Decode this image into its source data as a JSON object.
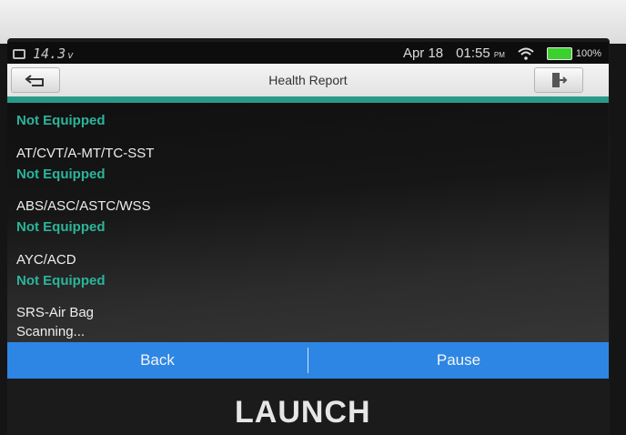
{
  "status_bar": {
    "voltage": "14.3",
    "voltage_unit": "v",
    "date": "Apr 18",
    "time": "01:55",
    "ampm": "PM",
    "battery": "100%"
  },
  "header": {
    "title": "Health Report"
  },
  "systems": [
    {
      "name": "",
      "status": "Not Equipped"
    },
    {
      "name": "AT/CVT/A-MT/TC-SST",
      "status": "Not Equipped"
    },
    {
      "name": "ABS/ASC/ASTC/WSS",
      "status": "Not Equipped"
    },
    {
      "name": "AYC/ACD",
      "status": "Not Equipped"
    },
    {
      "name": "SRS-Air Bag",
      "status": "Scanning..."
    }
  ],
  "footer": {
    "back_label": "Back",
    "pause_label": "Pause"
  },
  "brand": "LAUNCH",
  "colors": {
    "accent": "#2a9a88",
    "status_green": "#2bb59a",
    "button_blue": "#2d86e4"
  }
}
